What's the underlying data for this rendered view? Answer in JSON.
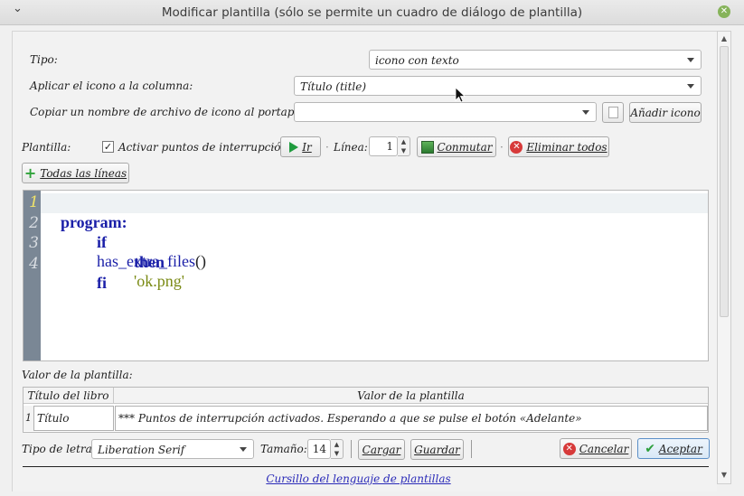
{
  "window": {
    "title": "Modificar plantilla (sólo se permite un cuadro de diálogo de plantilla)",
    "menu_glyph": "⌄",
    "close_glyph": "✕"
  },
  "form": {
    "tipo_label": "Tipo:",
    "tipo_value": "icono con texto",
    "aplicar_label": "Aplicar el icono a la columna:",
    "aplicar_value": "Título (title)",
    "copiar_label": "Copiar un nombre de archivo de icono al portapapeles",
    "copiar_value": "",
    "add_icon_button": "Añadir icono"
  },
  "toolbar": {
    "plantilla_label": "Plantilla:",
    "breakpoints_checkbox_label": "Activar puntos de interrupción",
    "breakpoints_checked": true,
    "go_button": "Ir",
    "linea_label": "Línea:",
    "linea_value": "1",
    "toggle_button": "Conmutar",
    "remove_all_button": "Eliminar todos",
    "all_lines_button": "Todas las líneas"
  },
  "editor": {
    "line_numbers": [
      "1",
      "2",
      "3",
      "4"
    ],
    "current_line": 1,
    "lines": {
      "l1_kw": "program:",
      "l2_kw": "if",
      "l2_fn": "has_extra_files",
      "l2_paren": "()",
      "l3_kw": "then",
      "l3_str": "'ok.png'",
      "l4_kw": "fi"
    }
  },
  "values_table": {
    "label": "Valor de la plantilla:",
    "col1_header": "Título del libro",
    "col2_header": "Valor de la plantilla",
    "row_index": "1",
    "row_title": "Título",
    "row_value": "*** Puntos de interrupción activados. Esperando a que se pulse el botón «Adelante»"
  },
  "bottom": {
    "font_label": "Tipo de letra:",
    "font_value": "Liberation Serif",
    "size_label": "Tamaño:",
    "size_value": "14",
    "load_button": "Cargar",
    "save_button": "Guardar",
    "cancel_button": "Cancelar",
    "accept_button": "Aceptar",
    "tutorial_link": "Cursillo del lenguaje de plantillas"
  },
  "colors": {
    "gutter": "#7a8795",
    "keyword": "#1a1fa8",
    "string": "#7a8a14",
    "link": "#2a2ab8"
  }
}
